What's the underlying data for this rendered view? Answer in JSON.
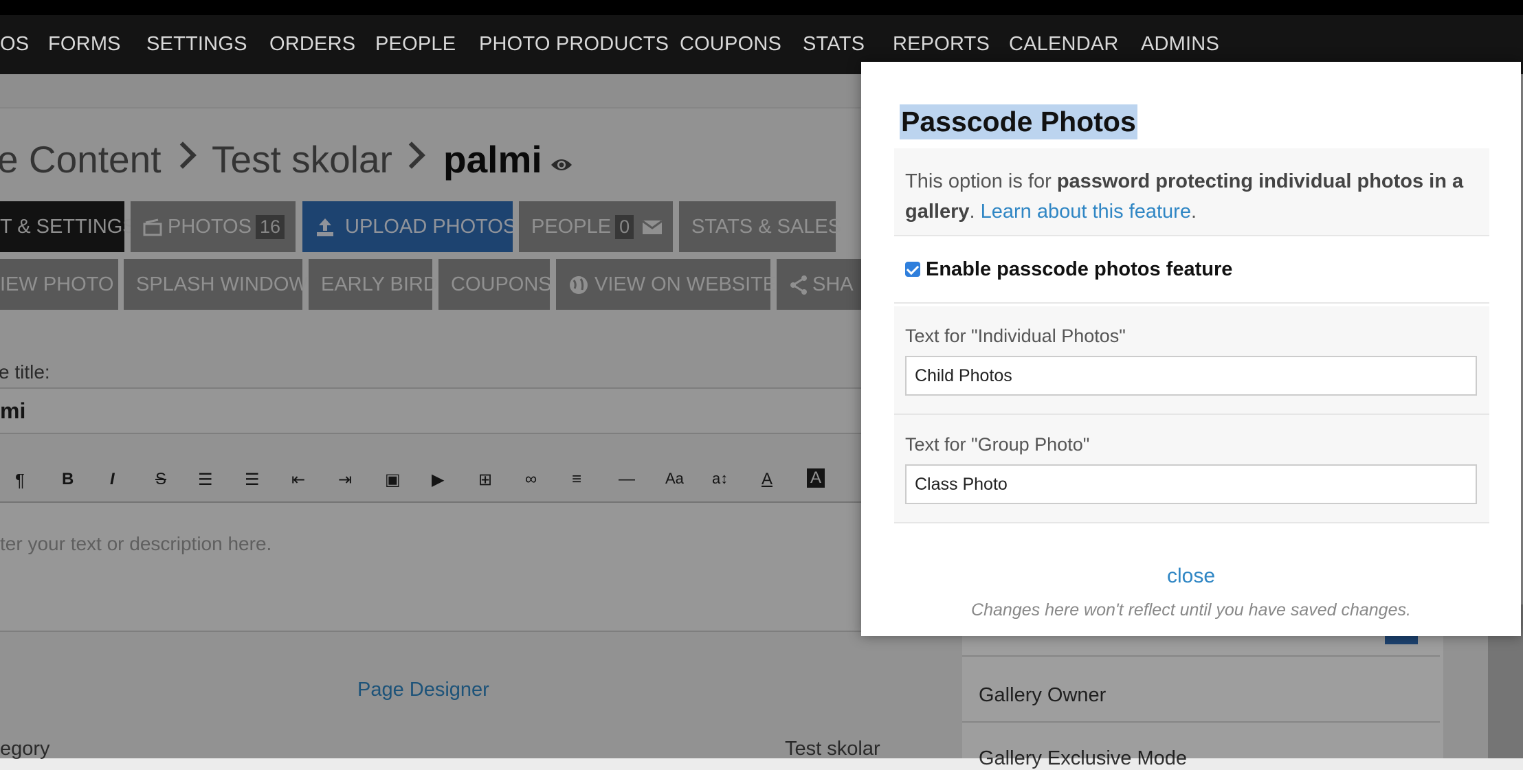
{
  "nav": {
    "items": [
      "OS",
      "FORMS",
      "SETTINGS",
      "ORDERS",
      "PEOPLE",
      "PHOTO PRODUCTS",
      "COUPONS",
      "STATS",
      "REPORTS",
      "CALENDAR",
      "ADMINS"
    ]
  },
  "breadcrumb": {
    "part1": "e Content",
    "part2": "Test skolar",
    "current": "palmi"
  },
  "tabs_row1": {
    "settings": "T & SETTINGS",
    "photos": "PHOTOS",
    "photos_count": "16",
    "upload": "UPLOAD PHOTOS",
    "people": "PEOPLE",
    "people_count": "0",
    "stats": "STATS & SALES"
  },
  "tabs_row2": {
    "view_photo": "IEW PHOTO",
    "splash": "SPLASH WINDOW",
    "early_bird": "EARLY BIRD",
    "coupons": "COUPONS",
    "view_website": "VIEW ON WEBSITE",
    "share": "SHA"
  },
  "page": {
    "title_label": "e title:",
    "title_value": "mi",
    "editor_placeholder": "ter your text or description here.",
    "page_designer": "Page Designer",
    "category_label": "egory",
    "category_value": "Test skolar",
    "gallery_owner": "Gallery Owner",
    "gallery_exclusive": "Gallery Exclusive Mode"
  },
  "modal": {
    "title": "Passcode Photos",
    "intro_prefix": "This option is for ",
    "intro_bold": "password protecting individual photos in a gallery",
    "intro_mid": ". ",
    "intro_link": "Learn about this feature",
    "intro_end": ".",
    "enable_label": "Enable passcode photos feature",
    "enable_checked": true,
    "individual_label": "Text for \"Individual Photos\"",
    "individual_value": "Child Photos",
    "group_label": "Text for \"Group Photo\"",
    "group_value": "Class Photo",
    "close": "close",
    "note": "Changes here won't reflect until you have saved changes."
  },
  "colors": {
    "accent_blue": "#2f6db5",
    "link_blue": "#2f86c4",
    "title_highlight": "#bcd4ef"
  }
}
